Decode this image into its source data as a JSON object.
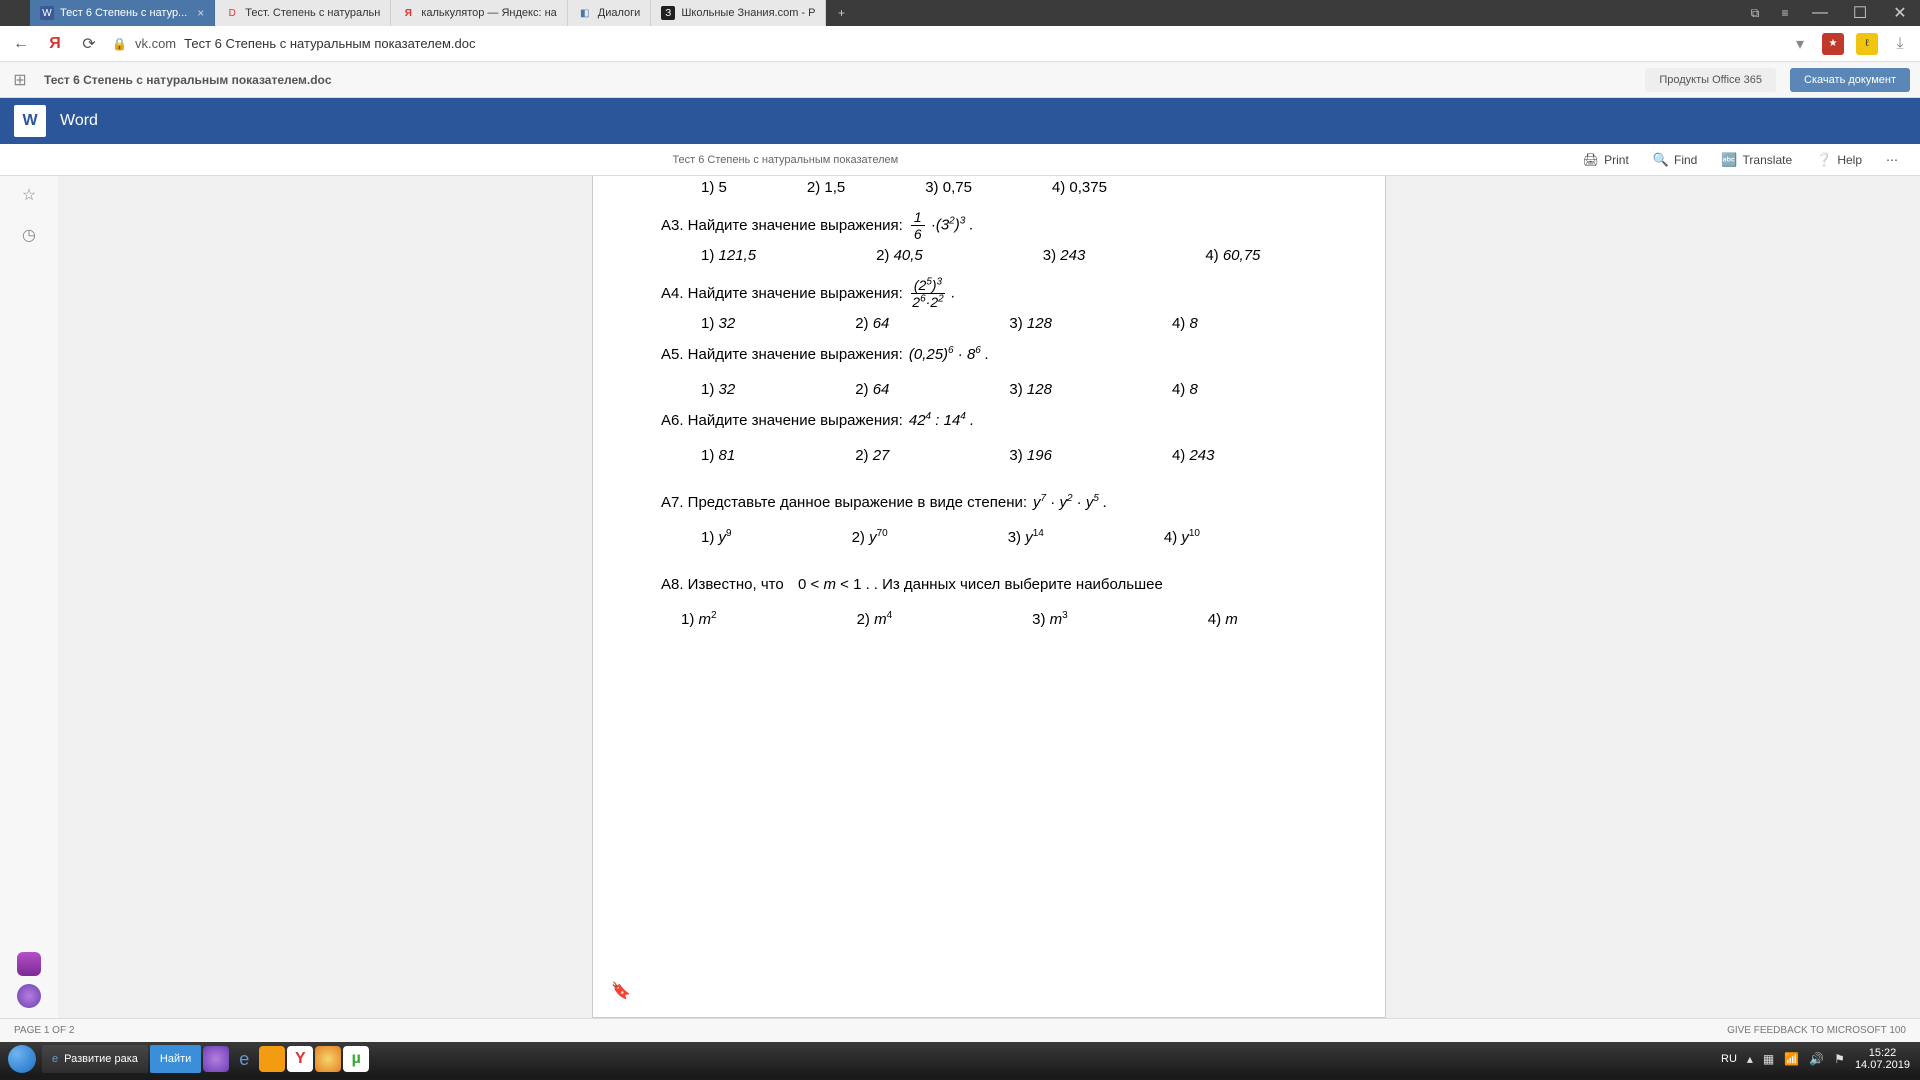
{
  "titlebar": {
    "tabs": [
      {
        "label": "Тест 6 Степень с натур...",
        "icon": "W"
      },
      {
        "label": "Тест. Степень с натуральн",
        "icon": "D"
      },
      {
        "label": "калькулятор — Яндекс: на",
        "icon": "Я"
      },
      {
        "label": "Диалоги",
        "icon": "◧"
      },
      {
        "label": "Школьные Знания.com - Р",
        "icon": "З"
      }
    ],
    "new_tab": "+"
  },
  "addressbar": {
    "domain": "vk.com",
    "path": "Тест 6 Степень с натуральным показателем.doc"
  },
  "doc_toolbar": {
    "name": "Тест 6 Степень с натуральным показателем.doc",
    "office": "Продукты Office 365",
    "download": "Скачать документ"
  },
  "word_header": {
    "label": "Word",
    "icon": "W"
  },
  "view_toolbar": {
    "title": "Тест 6 Степень с натуральным показателем",
    "print": "Print",
    "find": "Find",
    "translate": "Translate",
    "help": "Help"
  },
  "document": {
    "a2_answers": [
      "1) 5",
      "2) 1,5",
      "3) 0,75",
      "4) 0,375"
    ],
    "a3_prompt": "А3. Найдите значение выражения:",
    "a3_answers": [
      "1) 121,5",
      "2) 40,5",
      "3) 243",
      "4) 60,75"
    ],
    "a4_prompt": "А4. Найдите значение выражения:",
    "a4_answers": [
      "1) 32",
      "2) 64",
      "3) 128",
      "4) 8"
    ],
    "a5_prompt": "А5. Найдите значение выражения:",
    "a5_answers": [
      "1) 32",
      "2) 64",
      "3) 128",
      "4) 8"
    ],
    "a6_prompt": "А6. Найдите значение выражения:",
    "a6_answers": [
      "1) 81",
      "2) 27",
      "3) 196",
      "4) 243"
    ],
    "a7_prompt": "А7. Представьте данное выражение в виде степени:",
    "a7_answers_exp": [
      "9",
      "70",
      "14",
      "10"
    ],
    "a8_prompt": "А8. Известно, что",
    "a8_cond": "0 < m < 1",
    "a8_tail": ".   Из данных чисел выберите наибольшее",
    "a8_answers_exp": [
      "2",
      "4",
      "3",
      ""
    ]
  },
  "status": {
    "left": "PAGE 1 OF 2",
    "right": "GIVE FEEDBACK TO MICROSOFT   100"
  },
  "taskbar": {
    "ie": "Развитие рака",
    "find": "Найти",
    "lang": "RU",
    "time": "15:22",
    "date": "14.07.2019"
  }
}
